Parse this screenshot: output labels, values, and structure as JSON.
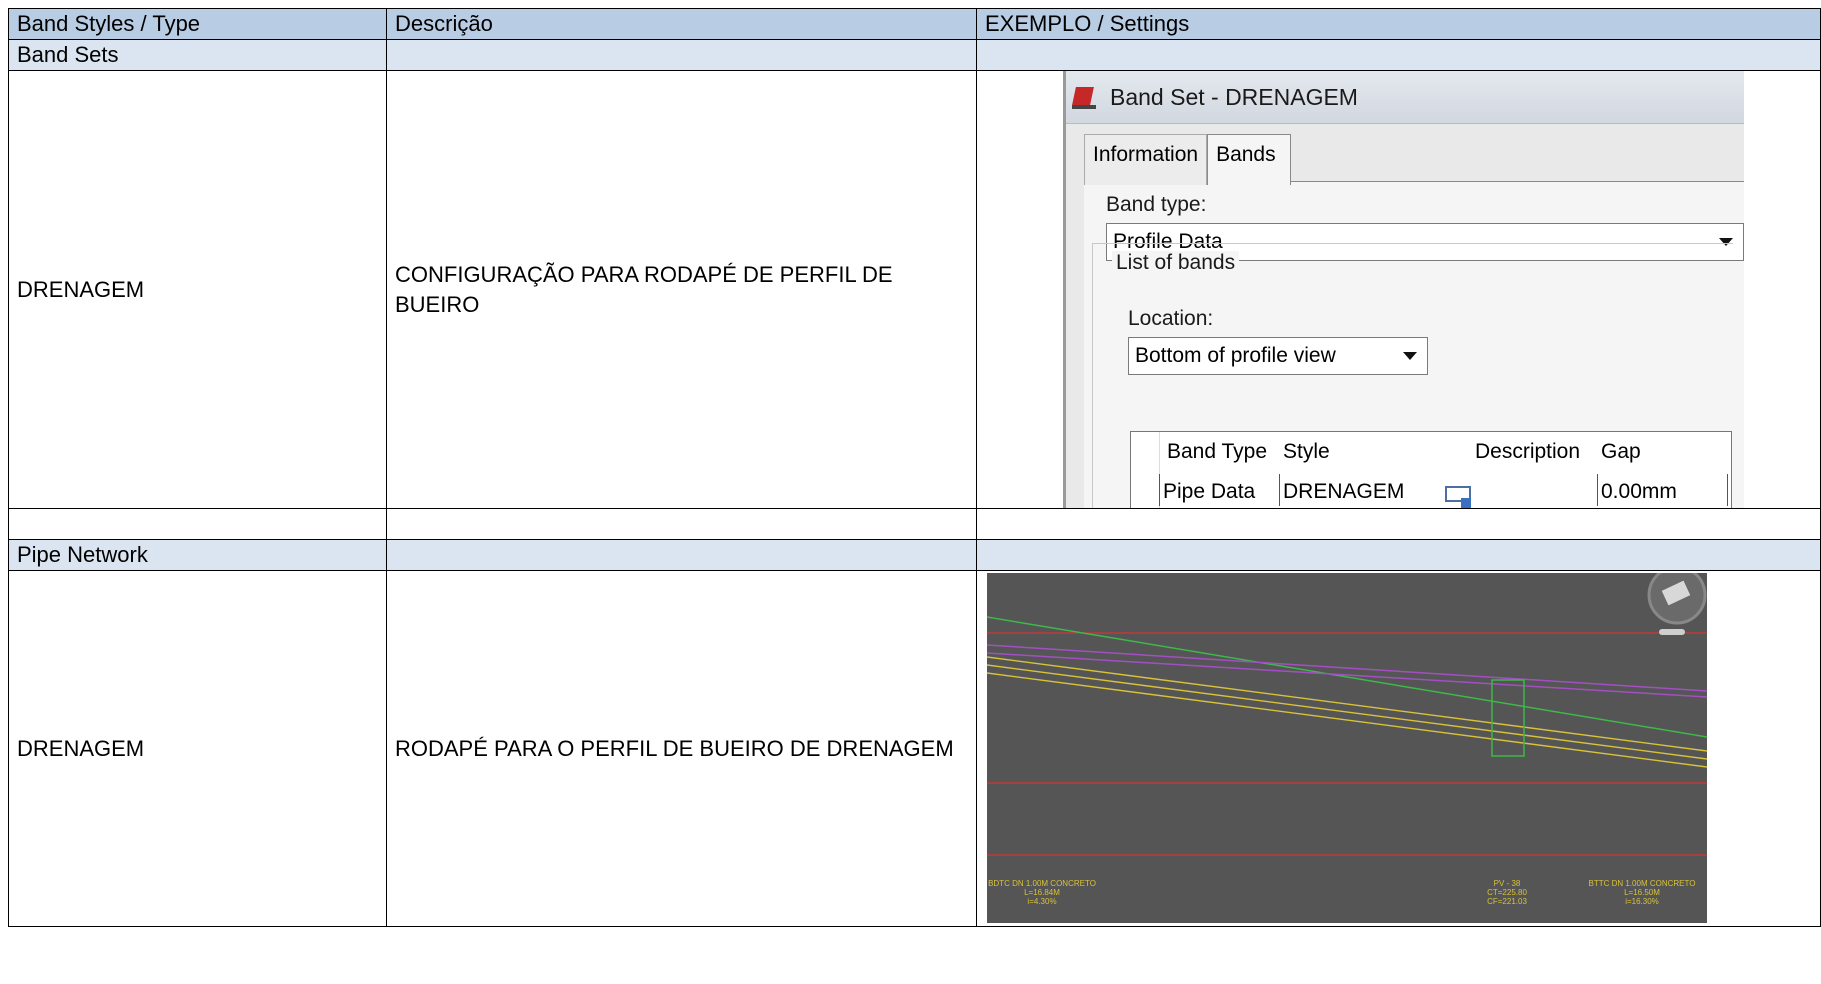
{
  "table": {
    "headers": [
      "Band  Styles / Type",
      "Descrição",
      "EXEMPLO / Settings"
    ],
    "sections": [
      {
        "title": "Band Sets"
      },
      {
        "title": "Pipe Network"
      }
    ],
    "rows": [
      {
        "type": "DRENAGEM",
        "description": "CONFIGURAÇÃO PARA RODAPÉ DE PERFIL DE BUEIRO"
      },
      {
        "type": "DRENAGEM",
        "description": "RODAPÉ PARA O PERFIL DE BUEIRO DE DRENAGEM"
      }
    ]
  },
  "band_set_dialog": {
    "title": "Band Set - DRENAGEM",
    "tabs": [
      "Information",
      "Bands"
    ],
    "active_tab": "Bands",
    "band_type_label": "Band type:",
    "band_type_value": "Profile Data",
    "list_group_label": "List of bands",
    "location_label": "Location:",
    "location_value": "Bottom of profile view",
    "grid_headers": [
      "Band Type",
      "Style",
      "Description",
      "Gap"
    ],
    "grid_row": {
      "band_type": "Pipe Data",
      "style": "DRENAGEM",
      "description": "",
      "gap": "0.00mm"
    }
  },
  "profile_view": {
    "background": "#555555",
    "label_left": [
      "BDTC DN 1.00M CONCRETO",
      "L=16.84M",
      "i=4.30%"
    ],
    "label_mid": [
      "PV - 38",
      "CT=225.80",
      "CF=221.03"
    ],
    "label_right": [
      "BTTC DN 1.00M CONCRETO",
      "L=16.50M",
      "i=16.30%"
    ]
  }
}
